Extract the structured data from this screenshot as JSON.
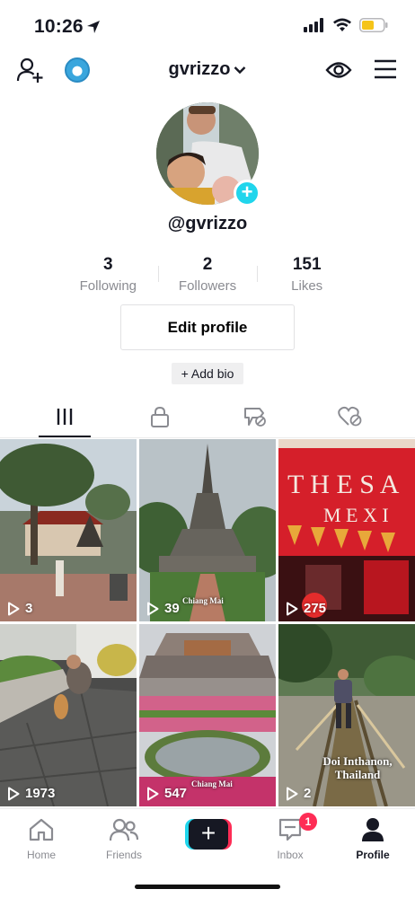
{
  "status_bar": {
    "time": "10:26"
  },
  "header": {
    "username": "gvrizzo"
  },
  "profile": {
    "handle": "@gvrizzo",
    "stats": [
      {
        "value": "3",
        "label": "Following"
      },
      {
        "value": "2",
        "label": "Followers"
      },
      {
        "value": "151",
        "label": "Likes"
      }
    ],
    "edit_profile_label": "Edit profile",
    "add_bio_label": "+ Add bio"
  },
  "tabs": [
    {
      "name": "videos-tab",
      "icon": "grid-lines-icon",
      "active": true
    },
    {
      "name": "private-tab",
      "icon": "lock-icon",
      "active": false
    },
    {
      "name": "favorites-tab",
      "icon": "bookmark-hidden-icon",
      "active": false
    },
    {
      "name": "liked-tab",
      "icon": "heart-hidden-icon",
      "active": false
    }
  ],
  "videos": [
    {
      "views": "3"
    },
    {
      "views": "39",
      "caption": "Chiang Mai"
    },
    {
      "views": "275"
    },
    {
      "views": "1973"
    },
    {
      "views": "547",
      "caption": "Chiang Mai"
    },
    {
      "views": "2",
      "caption": "Doi Inthanon, Thailand"
    }
  ],
  "nav": {
    "home": "Home",
    "friends": "Friends",
    "inbox": "Inbox",
    "inbox_badge": "1",
    "profile": "Profile"
  },
  "colors": {
    "accent_cyan": "#20d5ec",
    "accent_red": "#fe2c55",
    "text": "#161823",
    "muted": "#8a8b91"
  }
}
